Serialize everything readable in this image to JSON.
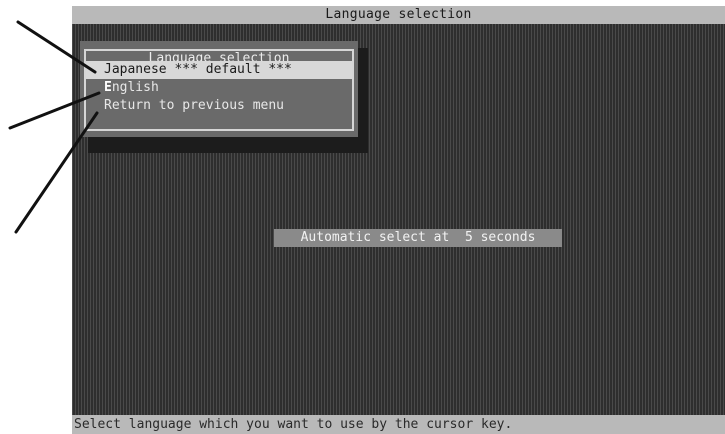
{
  "title_bar": {
    "label": "Language selection"
  },
  "dialog": {
    "title": "Language selection",
    "items": [
      {
        "label": "Japanese *** default ***",
        "selected": true
      },
      {
        "hotkey": "E",
        "rest": "nglish",
        "selected": false
      },
      {
        "label": "Return to previous menu",
        "selected": false
      }
    ]
  },
  "auto_select": {
    "label": "Automatic select at  5 seconds"
  },
  "status_bar": {
    "text": "Select language which you want to use by the cursor key."
  },
  "colors": {
    "background": "#3a3a3a",
    "bar": "#b9b9b9",
    "dialog": "#6a6a6a",
    "selected_item": "#d8d8d8",
    "auto_select_box": "#8a8a8a"
  },
  "icons": [
    "callout-line"
  ]
}
